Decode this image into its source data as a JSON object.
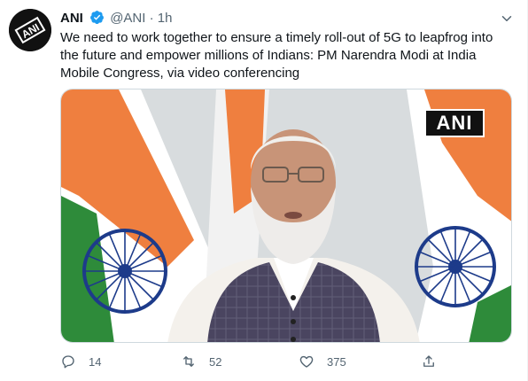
{
  "tweet": {
    "author_name": "ANI",
    "handle": "@ANI",
    "separator": "·",
    "time": "1h",
    "text": "We need to work together to ensure a timely roll-out of 5G to leapfrog into the future and empower millions of Indians: PM Narendra Modi at India Mobile Congress, via video conferencing",
    "avatar_logo_text": "ANI",
    "media_watermark": "ANI"
  },
  "actions": {
    "reply_count": "14",
    "retweet_count": "52",
    "like_count": "375"
  },
  "icons": {
    "verified": "verified-badge-icon",
    "caret": "chevron-down-icon",
    "reply": "reply-icon",
    "retweet": "retweet-icon",
    "like": "heart-icon",
    "share": "share-icon"
  },
  "colors": {
    "accent": "#1d9bf0",
    "muted": "#536471",
    "text": "#0f1419",
    "saffron": "#f4874b",
    "india_green": "#2e8b3a",
    "chakra": "#1d3b8a"
  }
}
